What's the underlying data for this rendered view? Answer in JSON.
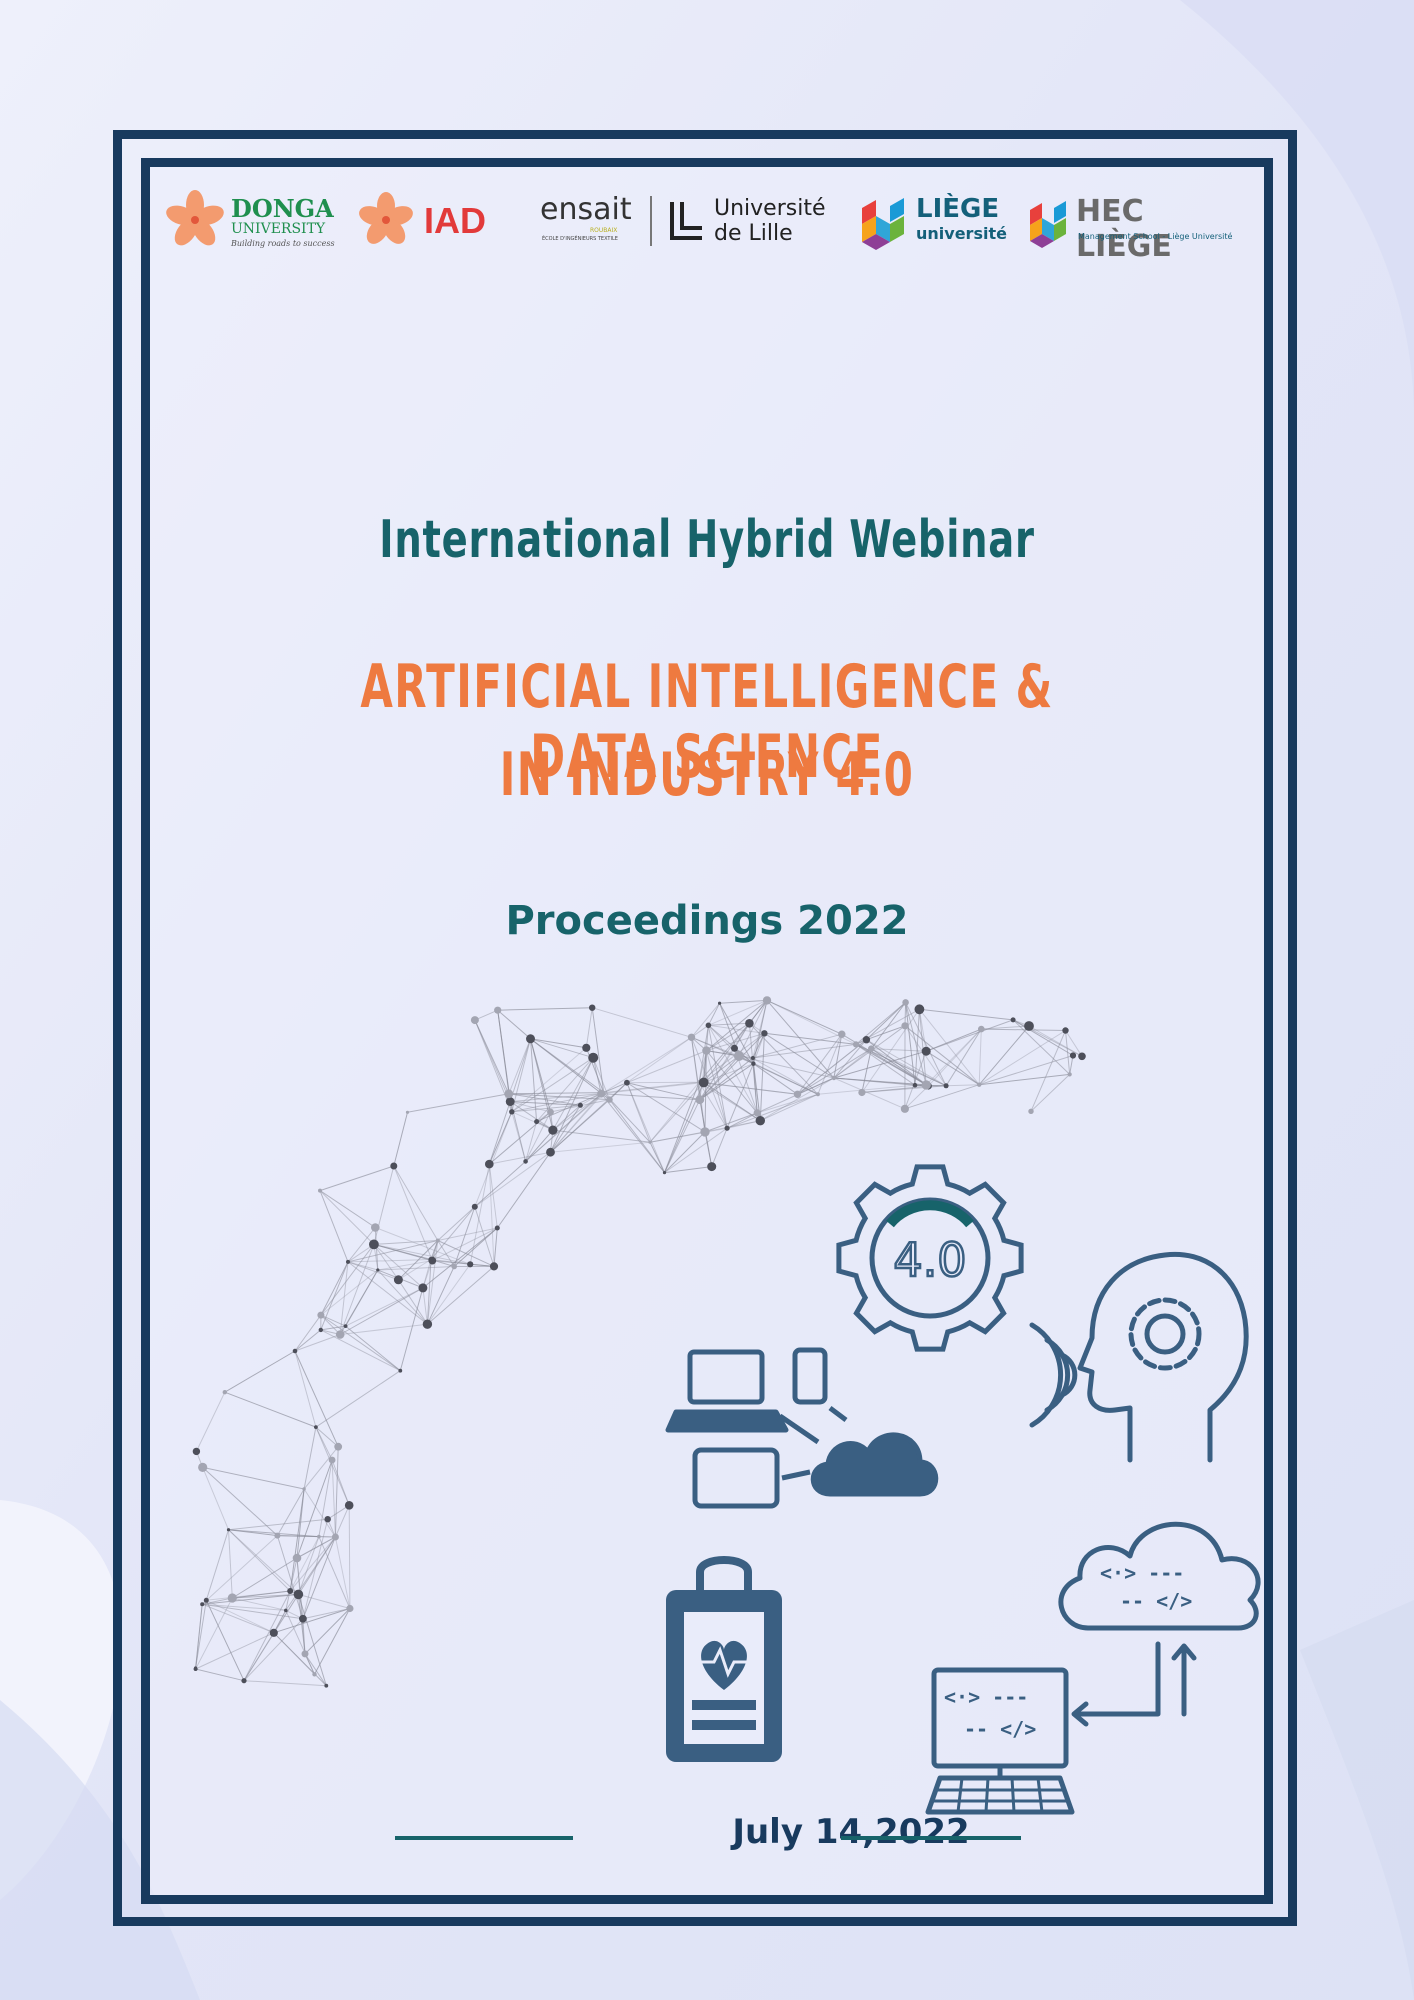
{
  "colors": {
    "frame": "#183a5e",
    "teal": "#17636a",
    "orange": "#ee7a40",
    "icon": "#3a5f82",
    "background": "#e4e7f8"
  },
  "logos": {
    "donga": {
      "name": "DONGA",
      "sub": "UNIVERSITY",
      "tagline": "Building roads to success",
      "icon": "flower-icon"
    },
    "iad": {
      "name": "IAD",
      "icon": "flower-icon"
    },
    "ensait": {
      "name": "ensait",
      "small": "ROUBAIX",
      "sub": "ÉCOLE D'INGÉNIEURS TEXTILE"
    },
    "lille": {
      "line1": "Université",
      "line2": "de Lille"
    },
    "liege": {
      "line1": "LIÈGE",
      "line2": "université"
    },
    "hec": {
      "name": "HEC LIÈGE",
      "sub": "Management School - Liège Université"
    }
  },
  "header": {
    "subtitle": "International Hybrid Webinar"
  },
  "title": {
    "line1": "ARTIFICIAL INTELLIGENCE & DATA SCIENCE",
    "line2": "IN INDUSTRY 4.0"
  },
  "proceedings": "Proceedings 2022",
  "illustration": {
    "gear_label": "4.0",
    "icons": [
      "network-icon",
      "industry-gear-icon",
      "ai-head-icon",
      "devices-cloud-icon",
      "medical-clipboard-icon",
      "cloud-code-icon",
      "computer-code-icon"
    ]
  },
  "footer": {
    "date": "July 14,2022"
  }
}
